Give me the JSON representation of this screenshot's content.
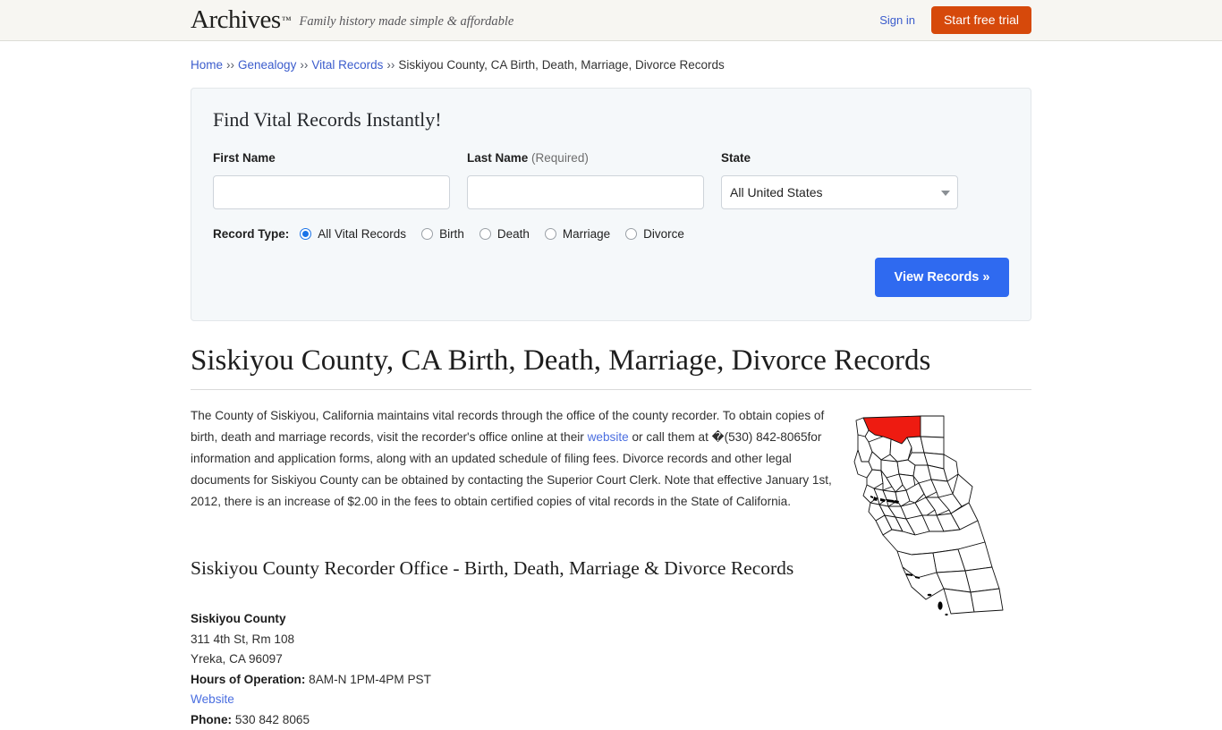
{
  "header": {
    "brand_name": "Archives",
    "brand_tm": "™",
    "tagline": "Family history made simple & affordable",
    "signin_label": "Sign in",
    "trial_label": "Start free trial",
    "trial_color": "#d6490b",
    "signin_color": "#3b5ccc"
  },
  "breadcrumb": {
    "items": [
      {
        "label": "Home",
        "link": true
      },
      {
        "label": "Genealogy",
        "link": true
      },
      {
        "label": "Vital Records",
        "link": true
      },
      {
        "label": "Siskiyou County, CA Birth, Death, Marriage, Divorce Records",
        "link": false
      }
    ],
    "separator": "››"
  },
  "search_panel": {
    "title": "Find Vital Records Instantly!",
    "first_name": {
      "label": "First Name",
      "value": "",
      "placeholder": ""
    },
    "last_name": {
      "label": "Last Name",
      "required_note": "(Required)",
      "value": "",
      "placeholder": ""
    },
    "state": {
      "label": "State",
      "selected": "All United States",
      "caret_icon": "chevron-down-icon"
    },
    "record_type": {
      "label": "Record Type:",
      "selected": "All Vital Records",
      "options": [
        "All Vital Records",
        "Birth",
        "Death",
        "Marriage",
        "Divorce"
      ]
    },
    "submit_label": "View Records »",
    "submit_color": "#2f6af0"
  },
  "main": {
    "page_title": "Siskiyou County, CA Birth, Death, Marriage, Divorce Records",
    "paragraph": {
      "part1": "The County of Siskiyou, California maintains vital records through the office of the county recorder. To obtain copies of birth, death and marriage records, visit the recorder's office online at their ",
      "link1": "website",
      "part2": " or call them at �(530) 842-8065for information and application forms, along with an updated schedule of filing fees. Divorce records and other legal documents for Siskiyou County can be obtained by contacting the Superior Court Clerk. Note that effective January 1st, 2012, there is an increase of $2.00 in the fees to obtain certified copies of vital records in the State of California."
    },
    "map": {
      "name": "california-county-map",
      "highlight_county": "Siskiyou",
      "highlight_color": "#ee1b11",
      "outline_color": "#000000"
    },
    "section_heading": "Siskiyou County Recorder Office - Birth, Death, Marriage & Divorce Records",
    "office": {
      "name": "Siskiyou County",
      "street": "311 4th St, Rm 108",
      "city_state_zip": "Yreka, CA 96097",
      "hours_label": "Hours of Operation:",
      "hours_value": "8AM-N 1PM-4PM PST",
      "website_label": "Website",
      "phone_label": "Phone:",
      "phone_value": "530 842 8065"
    }
  }
}
